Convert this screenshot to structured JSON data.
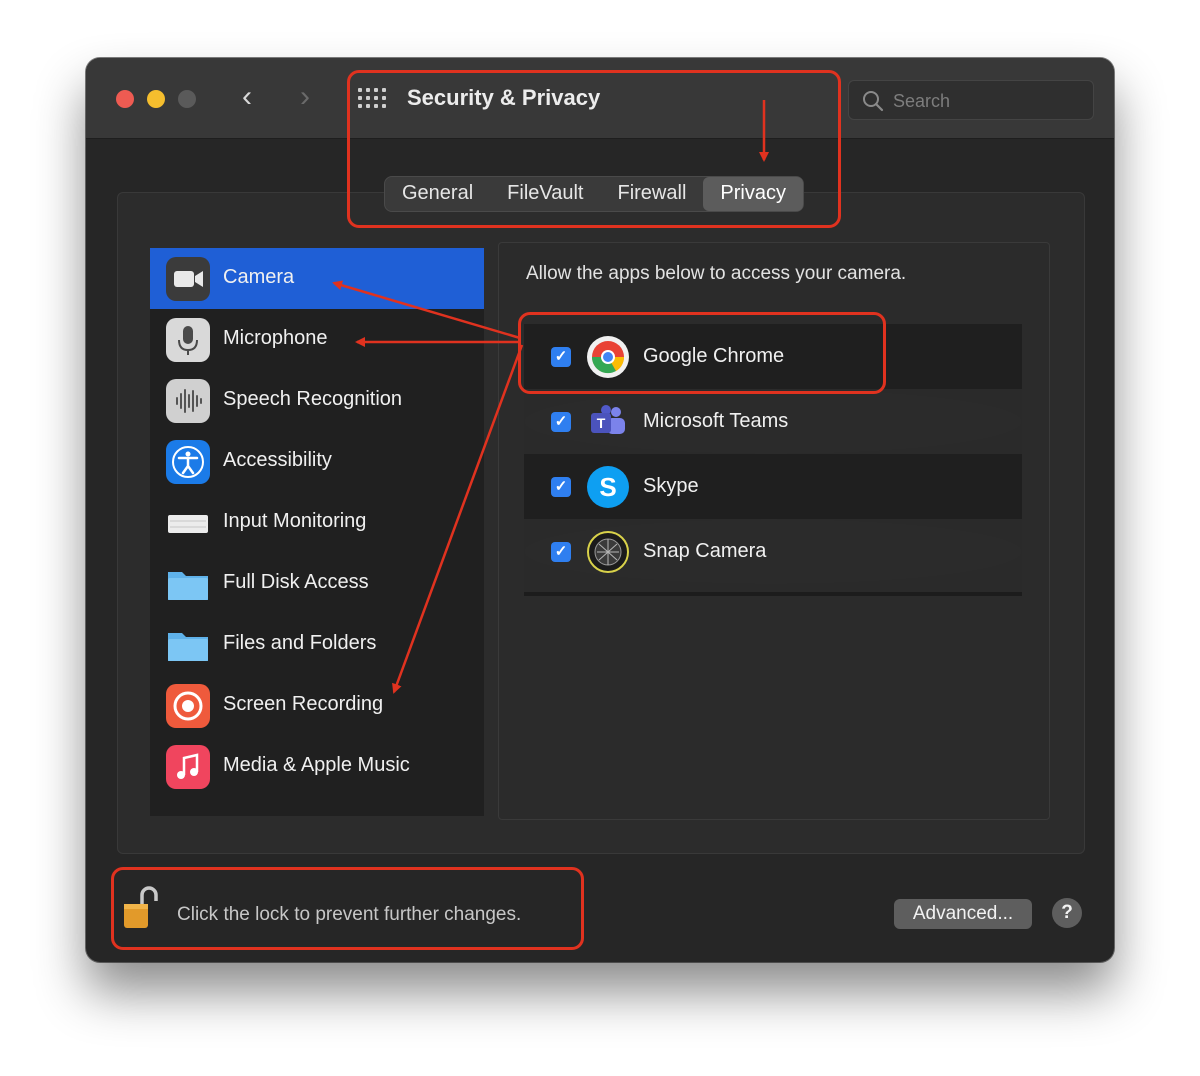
{
  "window": {
    "title": "Security & Privacy",
    "search_placeholder": "Search",
    "nav_back": "‹",
    "nav_forward": "›"
  },
  "tabs": [
    {
      "label": "General",
      "active": false
    },
    {
      "label": "FileVault",
      "active": false
    },
    {
      "label": "Firewall",
      "active": false
    },
    {
      "label": "Privacy",
      "active": true
    }
  ],
  "sidebar": {
    "items": [
      {
        "label": "Camera",
        "icon": "camera-icon",
        "selected": true
      },
      {
        "label": "Microphone",
        "icon": "microphone-icon",
        "selected": false
      },
      {
        "label": "Speech Recognition",
        "icon": "waveform-icon",
        "selected": false
      },
      {
        "label": "Accessibility",
        "icon": "accessibility-icon",
        "selected": false
      },
      {
        "label": "Input Monitoring",
        "icon": "keyboard-icon",
        "selected": false
      },
      {
        "label": "Full Disk Access",
        "icon": "folder-icon",
        "selected": false
      },
      {
        "label": "Files and Folders",
        "icon": "folder-icon",
        "selected": false
      },
      {
        "label": "Screen Recording",
        "icon": "screen-recording-icon",
        "selected": false
      },
      {
        "label": "Media & Apple Music",
        "icon": "music-icon",
        "selected": false
      }
    ]
  },
  "panel": {
    "description": "Allow the apps below to access your camera.",
    "apps": [
      {
        "name": "Google Chrome",
        "icon": "chrome-icon",
        "checked": true
      },
      {
        "name": "Microsoft Teams",
        "icon": "teams-icon",
        "checked": true
      },
      {
        "name": "Skype",
        "icon": "skype-icon",
        "checked": true
      },
      {
        "name": "Snap Camera",
        "icon": "snap-camera-icon",
        "checked": true
      }
    ]
  },
  "footer": {
    "lock_text": "Click the lock to prevent further changes.",
    "advanced_label": "Advanced...",
    "help_label": "?"
  },
  "colors": {
    "selection": "#1f5fd6",
    "checkbox": "#2f7ff0",
    "annotation": "#e0321f"
  }
}
